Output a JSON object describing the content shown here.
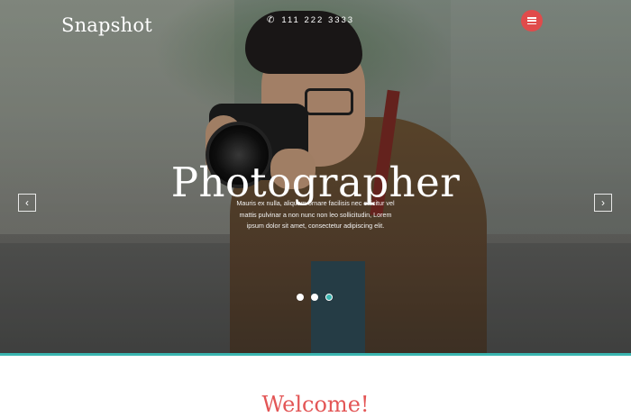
{
  "header": {
    "logo": "Snapshot",
    "phone": "111 222 3333",
    "phone_icon": "phone-icon",
    "menu_icon": "hamburger-icon",
    "accent_color": "#e04b4b"
  },
  "hero": {
    "headline": "Photographer",
    "description": "Mauris ex nulla, aliquam ornare facilisis nec efficitur vel mattis pulvinar a non nunc non leo sollicitudin, Lorem ipsum dolor sit amet, consectetur adipiscing elit.",
    "prev_icon": "chevron-left-icon",
    "next_icon": "chevron-right-icon",
    "slides_total": 3,
    "active_slide": 3,
    "accent_color": "#3ab5b0"
  },
  "welcome": {
    "title": "Welcome!"
  }
}
